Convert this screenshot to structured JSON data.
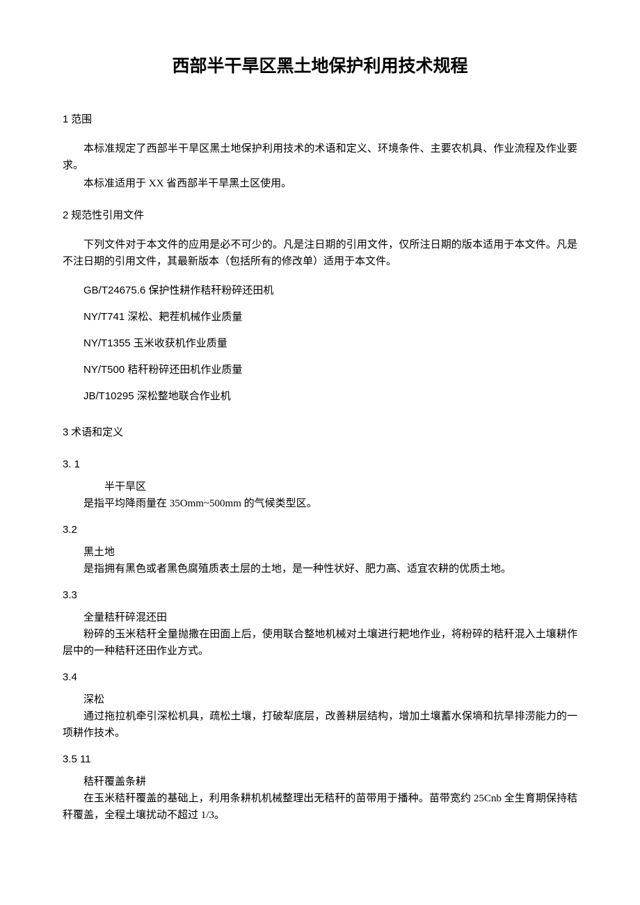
{
  "title": "西部半干旱区黑土地保护利用技术规程",
  "s1": {
    "num": "1",
    "heading": "范围",
    "p1": "本标准规定了西部半干旱区黑土地保护利用技术的术语和定义、环境条件、主要农机具、作业流程及作业要求。",
    "p2": "本标准适用于 XX 省西部半干旱黑土区使用。"
  },
  "s2": {
    "num": "2",
    "heading": "规范性引用文件",
    "p1": "下列文件对于本文件的应用是必不可少的。凡是注日期的引用文件，仅所注日期的版本适用于本文件。凡是不注日期的引用文件，其最新版本（包括所有的修改单）适用于本文件。",
    "refs": [
      {
        "code": "GB/T24675.6",
        "title": "保护性耕作秸秆粉碎还田机"
      },
      {
        "code": "NY/T741",
        "title": "深松、耙茬机械作业质量"
      },
      {
        "code": "NY/T1355",
        "title": "玉米收获机作业质量"
      },
      {
        "code": "NY/T500",
        "title": "秸秆粉碎还田机作业质量"
      },
      {
        "code": "JB/T10295",
        "title": "深松整地联合作业机"
      }
    ]
  },
  "s3": {
    "num": "3",
    "heading": "术语和定义",
    "t1": {
      "num": "3.  1",
      "name": "半干旱区",
      "def": "是指平均降雨量在 35Omm~500mm 的气候类型区。"
    },
    "t2": {
      "num": "3.2",
      "name": "黑土地",
      "def": "是指拥有黑色或者黑色腐殖质表土层的土地，是一种性状好、肥力高、适宜农耕的优质土地。"
    },
    "t3": {
      "num": "3.3",
      "name": "全量秸秆碎混还田",
      "def": "粉碎的玉米秸秆全量抛撒在田面上后，使用联合整地机械对土壤进行耙地作业，将粉碎的秸秆混入土壤耕作层中的一种秸秆还田作业方式。"
    },
    "t4": {
      "num": "3.4",
      "name": "深松",
      "def": "通过拖拉机牵引深松机具，疏松土壤，打破犁底层，改善耕层结构，增加土壤蓄水保墒和抗旱排涝能力的一项耕作技术。"
    },
    "t5": {
      "num": "3.5   11",
      "name": "秸秆覆盖条耕",
      "def": "在玉米秸秆覆盖的基础上，利用条耕机机械整理出无秸秆的苗带用于播种。苗带宽约 25Cnb 全生育期保持秸秆覆盖，全程土壤扰动不超过 1/3。"
    }
  }
}
